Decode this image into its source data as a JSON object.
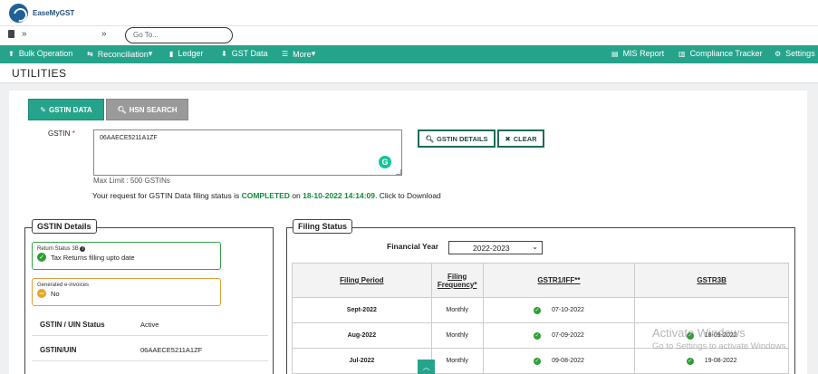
{
  "app": {
    "logo_text": "EaseMyGST"
  },
  "subbar": {
    "chevron1": "»",
    "chevron2": "»",
    "goto_placeholder": "Go To..."
  },
  "nav": {
    "bulk": "Bulk Operation",
    "reconciliation": "Reconciliation",
    "ledger": "Ledger",
    "gst_data": "GST Data",
    "more": "More",
    "mis": "MIS Report",
    "compliance": "Compliance Tracker",
    "settings": "Settings",
    "dropdown_caret": "▾"
  },
  "page": {
    "title": "UTILITIES"
  },
  "tabs": {
    "gstin_data": "GSTIN DATA",
    "hsn_search": "HSN SEARCH"
  },
  "form": {
    "gstin_label": "GSTIN",
    "required_mark": "*",
    "gstin_value": "06AAECE5211A1ZF",
    "max_limit": "Max Limit : 500 GSTINs",
    "gstin_details_btn": "GSTIN DETAILS",
    "clear_btn": "CLEAR",
    "grammarly_badge": "G"
  },
  "status": {
    "prefix": "Your request for GSTIN Data filing status is ",
    "state": "COMPLETED",
    "on": " on ",
    "datetime": "18-10-2022 14:14:09",
    "suffix": ". Click to Download"
  },
  "gstin_details": {
    "legend": "GSTIN Details",
    "return_status_title": "Return Status 3B",
    "return_status_info": "i",
    "return_status_value": "Tax Returns filling upto date",
    "einvoice_title": "Generated e-invoices",
    "einvoice_value": "No",
    "rows": [
      {
        "key": "GSTIN / UIN Status",
        "value": "Active"
      },
      {
        "key": "GSTIN/UIN",
        "value": "06AAECE5211A1ZF"
      }
    ]
  },
  "filing_status": {
    "legend": "Filing Status",
    "fy_label": "Financial Year",
    "fy_value": "2022-2023",
    "columns": [
      "Filing Period",
      "Filing Frequency*",
      "GSTR1/IFF**",
      "GSTR3B"
    ],
    "rows": [
      {
        "period": "Sept-2022",
        "frequency": "Monthly",
        "gstr1": "07-10-2022",
        "gstr3b": ""
      },
      {
        "period": "Aug-2022",
        "frequency": "Monthly",
        "gstr1": "07-09-2022",
        "gstr3b": "18-09-2022"
      },
      {
        "period": "Jul-2022",
        "frequency": "Monthly",
        "gstr1": "09-08-2022",
        "gstr3b": "19-08-2022"
      }
    ]
  },
  "watermark": {
    "line1": "Activate Windows",
    "line2": "Go to Settings to activate Windows."
  },
  "colors": {
    "brand_green": "#26a38b",
    "success": "#2d9f35",
    "warning": "#e8a524"
  }
}
